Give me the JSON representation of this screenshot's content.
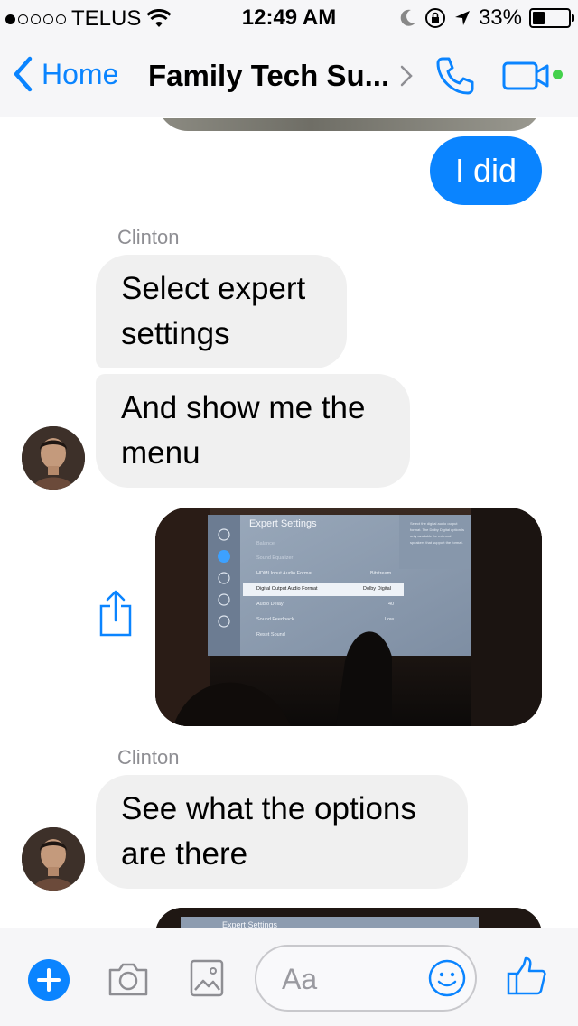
{
  "status_bar": {
    "carrier": "TELUS",
    "time": "12:49 AM",
    "battery": "33%",
    "battery_level": 0.33
  },
  "nav": {
    "back_label": "Home",
    "title": "Family Tech Su..."
  },
  "messages": {
    "sent_1": "I did",
    "sender_1": "Clinton",
    "recv_1": "Select expert settings",
    "recv_2": "And show me the menu",
    "sender_2": "Clinton",
    "recv_3": "See what the options are there"
  },
  "photo_menu": {
    "title": "Expert Settings",
    "items": [
      {
        "label": "Balance",
        "value": ""
      },
      {
        "label": "Sound Equalizer",
        "value": ""
      },
      {
        "label": "HDMI Input Audio Format",
        "value": "Bitstream"
      },
      {
        "label": "Digital Output Audio Format",
        "value": "Dolby Digital"
      },
      {
        "label": "Audio Delay",
        "value": "40"
      },
      {
        "label": "Sound Feedback",
        "value": "Low"
      },
      {
        "label": "Reset Sound",
        "value": ""
      }
    ],
    "help_text": "Select the digital audio output format. The Dolby Digital option is only available for external speakers that support the format."
  },
  "photo_partial_title": "Expert Settings",
  "input": {
    "placeholder": "Aa"
  },
  "colors": {
    "accent": "#0a84ff",
    "bubble_received": "#f0f0f0",
    "online": "#44d14c"
  }
}
